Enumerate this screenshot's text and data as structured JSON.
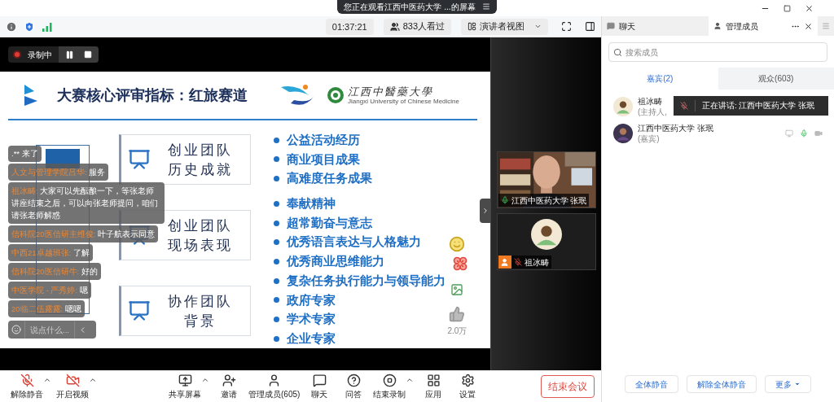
{
  "screen_share_banner": {
    "text": "您正在观看江西中医药大学 ...的屏幕"
  },
  "info_bar": {
    "time": "01:37:21",
    "viewers": "833人看过",
    "view_mode": "演讲者视图"
  },
  "recording": {
    "label": "录制中"
  },
  "slide": {
    "title": "大赛核心评审指标：红旅赛道",
    "logo_name": "江西中醫藥大學",
    "logo_subtitle": "Jiangxi University of Chinese Medicine",
    "categories": [
      {
        "lines": [
          "创业团队",
          "历史成就"
        ]
      },
      {
        "lines": [
          "创业团队",
          "现场表现"
        ]
      },
      {
        "lines": [
          "协作团队",
          "背景"
        ]
      }
    ],
    "bullet_groups": [
      [
        "公益活动经历",
        "商业项目成果",
        "高难度任务成果"
      ],
      [
        "奉献精神",
        "超常勤奋与意志",
        "优秀语言表达与人格魅力",
        "优秀商业思维能力",
        "复杂任务执行能力与领导能力",
        "政府专家",
        "学术专家",
        "企业专家"
      ]
    ]
  },
  "reactions": {
    "like_count": "2.0万"
  },
  "chat": {
    "messages": [
      {
        "kind": "system",
        "text": ".** 来了"
      },
      {
        "kind": "message",
        "sender": "人文与管理学院吕华:",
        "text": "服务"
      },
      {
        "kind": "message",
        "sender": "祖冰畴:",
        "text": "大家可以先酝酿一下，等张老师讲座结束之后，可以向张老师提问，咱们请张老师解惑"
      },
      {
        "kind": "message",
        "sender": "信科院20医信研主维俊:",
        "text": "叶子航表示同意"
      },
      {
        "kind": "message",
        "sender": "中西21卓越班张:",
        "text": "了解"
      },
      {
        "kind": "message",
        "sender": "信科院20医信研牛:",
        "text": "好的"
      },
      {
        "kind": "message",
        "sender": "中医学院 - 严秀婷:",
        "text": "嗯"
      },
      {
        "kind": "message",
        "sender": "20临二伍露露:",
        "text": "嗯嗯"
      }
    ],
    "placeholder": "说点什么..."
  },
  "videos": [
    {
      "kind": "camera",
      "name": "江西中医药大学 张珉",
      "muted": false
    },
    {
      "kind": "avatar",
      "name": "祖冰畴",
      "muted": true
    }
  ],
  "panel": {
    "tabs": [
      {
        "label": "聊天",
        "selected": false
      },
      {
        "label": "管理成员",
        "selected": true
      }
    ],
    "search_placeholder": "搜索成员",
    "member_tabs": [
      {
        "label": "嘉宾(2)",
        "selected": true
      },
      {
        "label": "观众(603)",
        "selected": false
      }
    ],
    "members": [
      {
        "name": "祖冰畴",
        "role": "(主持人,"
      },
      {
        "name": "江西中医药大学 张珉",
        "role": "(嘉宾)"
      }
    ],
    "speaking_toast": "正在讲话: 江西中医药大学 张珉",
    "buttons": [
      {
        "label": "全体静音",
        "menu": false
      },
      {
        "label": "解除全体静音",
        "menu": false
      },
      {
        "label": "更多",
        "menu": true
      }
    ]
  },
  "bottom_bar": {
    "items": [
      {
        "kind": "mic_off",
        "label": "解除静音",
        "menu": true
      },
      {
        "kind": "camera_off",
        "label": "开启视频",
        "menu": true
      },
      {
        "kind": "share",
        "label": "共享屏幕",
        "menu": true
      },
      {
        "kind": "invite",
        "label": "邀请",
        "menu": false
      },
      {
        "kind": "members",
        "label": "管理成员(605)",
        "menu": false
      },
      {
        "kind": "chat",
        "label": "聊天",
        "menu": false
      },
      {
        "kind": "qa",
        "label": "问答",
        "menu": false
      },
      {
        "kind": "stop_record",
        "label": "结束录制",
        "menu": true
      },
      {
        "kind": "apps",
        "label": "应用",
        "menu": false
      },
      {
        "kind": "settings",
        "label": "设置",
        "menu": false
      }
    ],
    "end_button": "结束会议"
  }
}
